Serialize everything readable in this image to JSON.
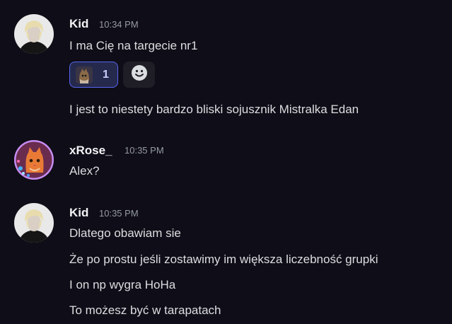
{
  "messages": [
    {
      "author": "Kid",
      "timestamp": "10:34 PM",
      "avatar_icon": "user-avatar",
      "lines": [
        "I ma Cię na targecie nr1"
      ],
      "reaction": {
        "emoji_icon": "cat-emoji",
        "count": "1"
      },
      "add_reaction_icon": "smile-icon"
    },
    {
      "lines": [
        "I jest to niestety bardzo bliski sojusznik Mistralka Edan"
      ]
    },
    {
      "author": "xRose_",
      "timestamp": "10:35 PM",
      "avatar_icon": "cat-avatar",
      "lines": [
        "Alex?"
      ]
    },
    {
      "author": "Kid",
      "timestamp": "10:35 PM",
      "avatar_icon": "user-avatar",
      "lines": [
        "Dlatego obawiam sie",
        "Że po prostu jeśli zostawimy im większa liczebność grupki",
        "I on np wygra HoHa",
        "To możesz być w tarapatach"
      ]
    }
  ],
  "colors": {
    "background": "#0f0d17",
    "username": "#f2f3f5",
    "message_text": "#dbdee1",
    "timestamp": "#949ba4",
    "reaction_border": "#5865f2",
    "reaction_bg": "#252a4d"
  }
}
